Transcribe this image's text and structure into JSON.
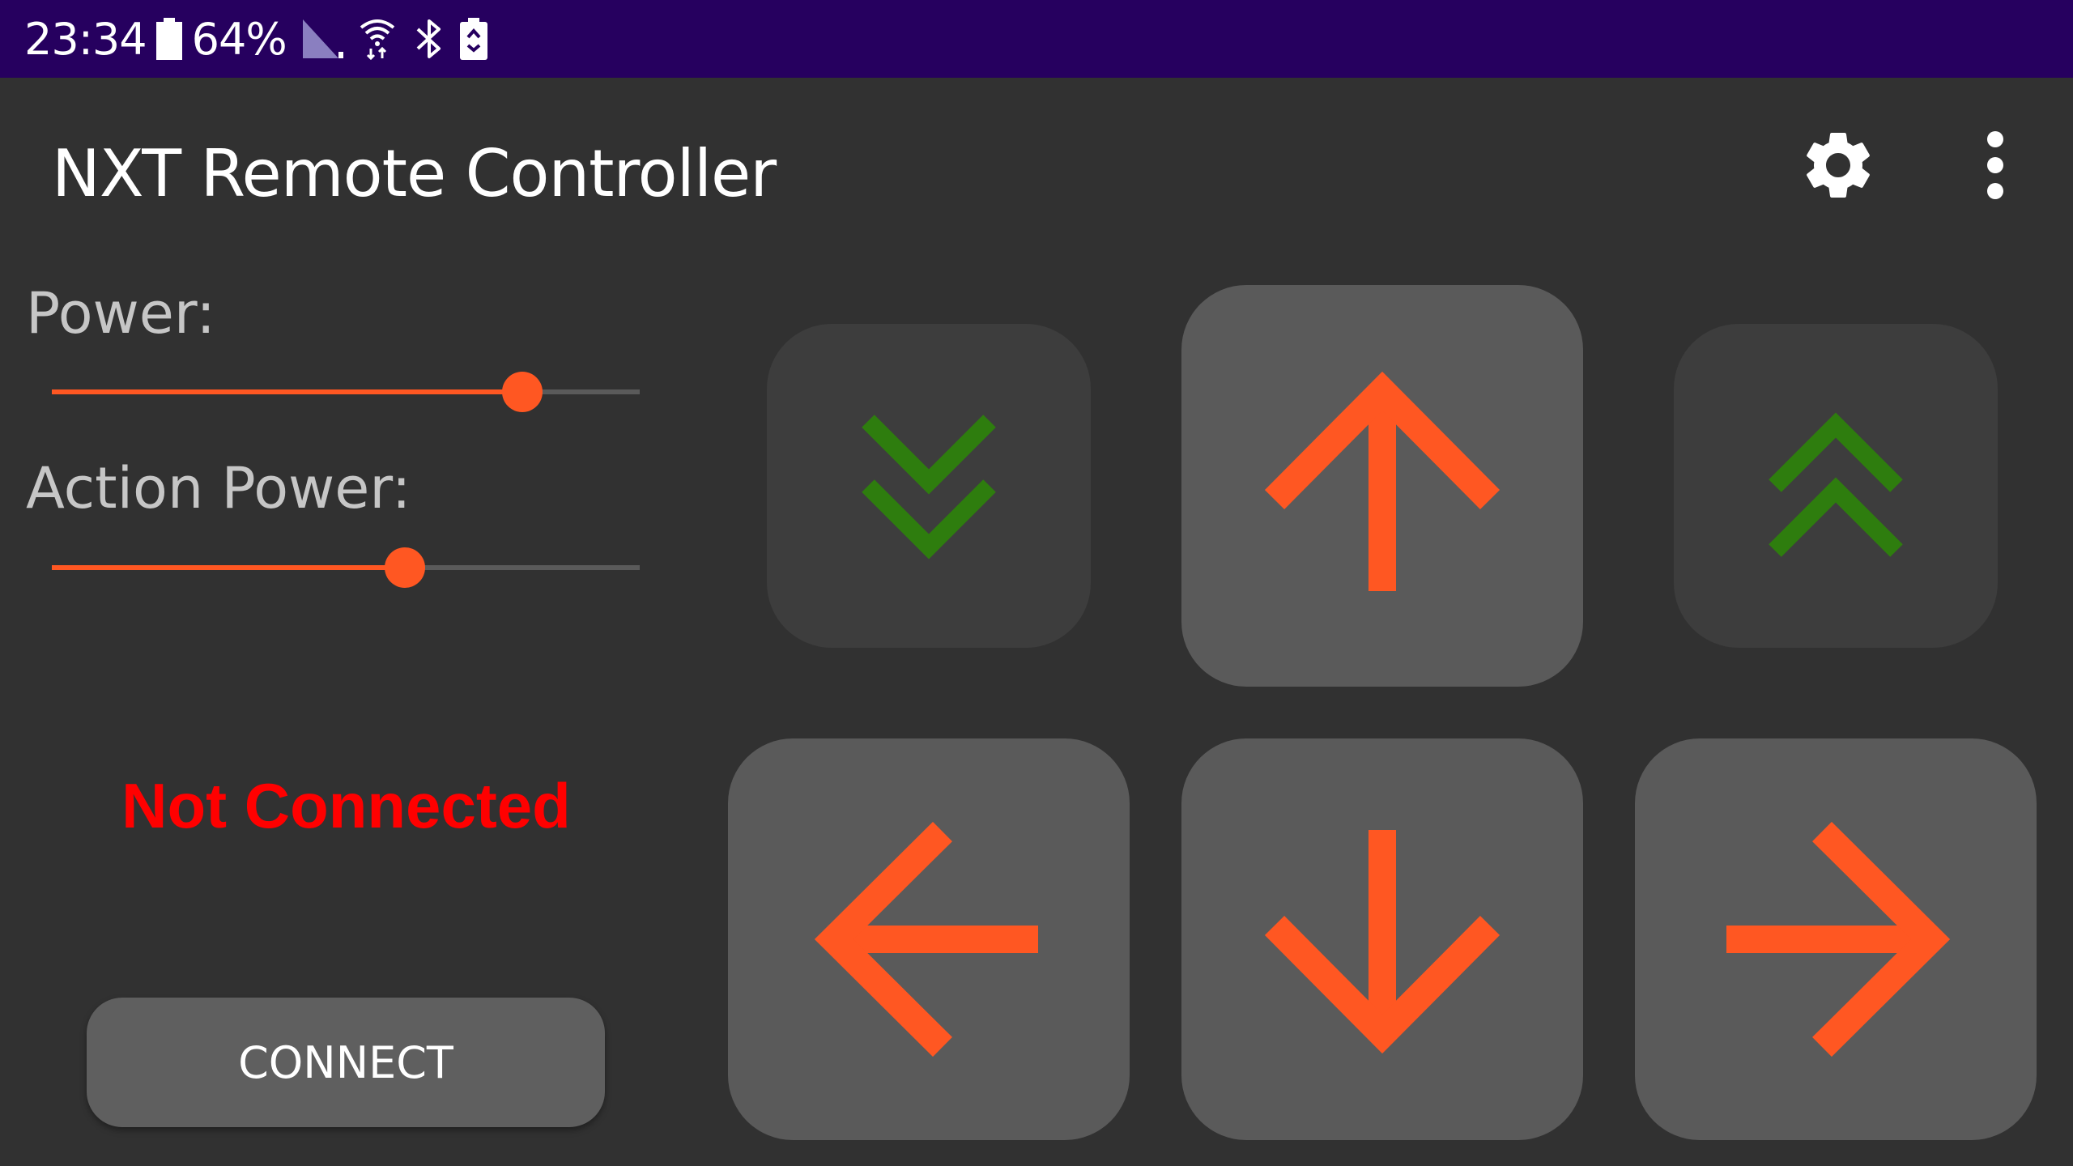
{
  "status_bar": {
    "time": "23:34",
    "battery_percent": "64%",
    "icons": [
      "battery-icon",
      "signal-icon",
      "wifi-icon",
      "bluetooth-icon",
      "battery-saver-icon"
    ]
  },
  "app_bar": {
    "title": "NXT Remote Controller",
    "actions": [
      "settings-icon",
      "more-vert-icon"
    ]
  },
  "controls": {
    "power_label": "Power:",
    "power_value": 0.8,
    "action_power_label": "Action Power:",
    "action_power_value": 0.6
  },
  "connection": {
    "status": "Not Connected",
    "button_label": "CONNECT"
  },
  "pad": {
    "buttons": [
      "action-down",
      "forward",
      "action-up",
      "left",
      "backward",
      "right"
    ]
  },
  "colors": {
    "status_bar": "#26005f",
    "background": "#313131",
    "accent": "#ff5722",
    "action_arrows": "#2e7d0e",
    "error_text": "#ff0000"
  }
}
